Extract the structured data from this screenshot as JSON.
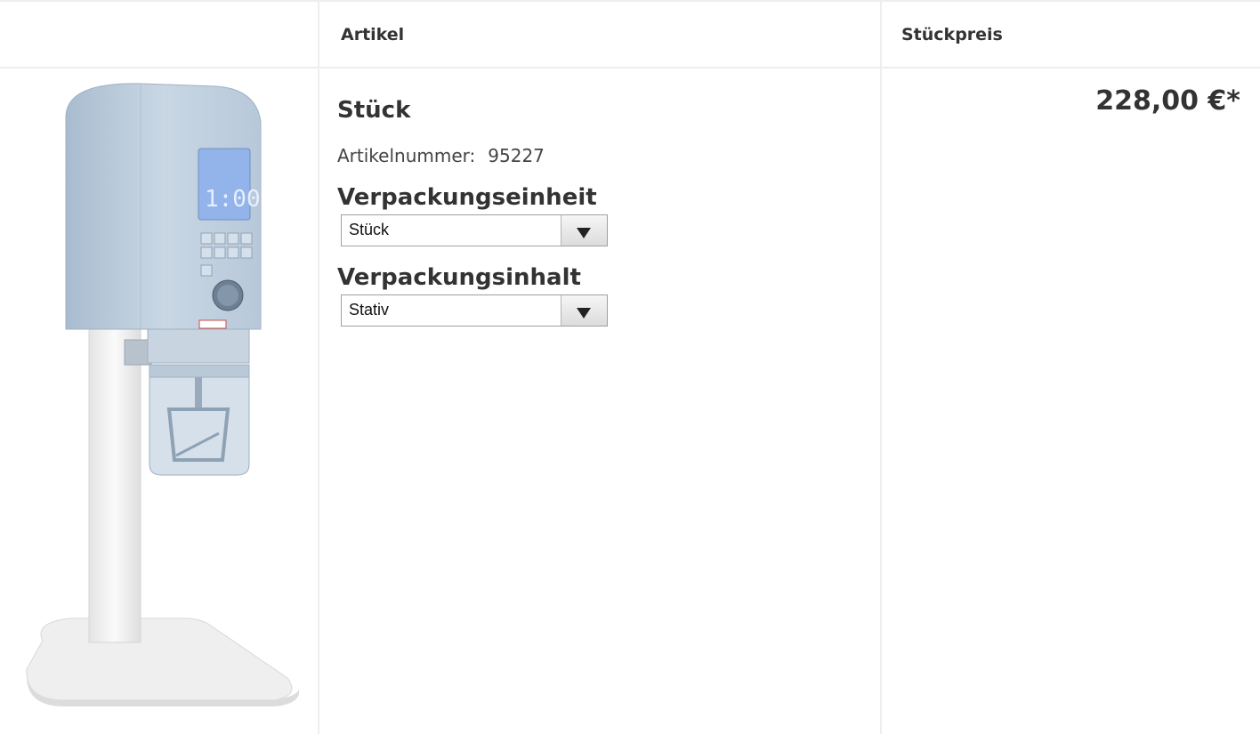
{
  "table": {
    "headers": {
      "artikel": "Artikel",
      "stueckpreis": "Stückpreis"
    }
  },
  "product": {
    "image_alt": "Produktbild",
    "title": "Stück",
    "number_label": "Artikelnummer:",
    "number": "95227",
    "price": "228,00 €*",
    "options": [
      {
        "label": "Verpackungseinheit",
        "selected": "Stück"
      },
      {
        "label": "Verpackungsinhalt",
        "selected": "Stativ"
      }
    ],
    "display_text": "1:00"
  },
  "colors": {
    "device_body": "#c7d5e3",
    "device_display": "#8fb0e6",
    "stand": "#f1f1f1",
    "text": "#333333",
    "border": "#eeeeee"
  }
}
